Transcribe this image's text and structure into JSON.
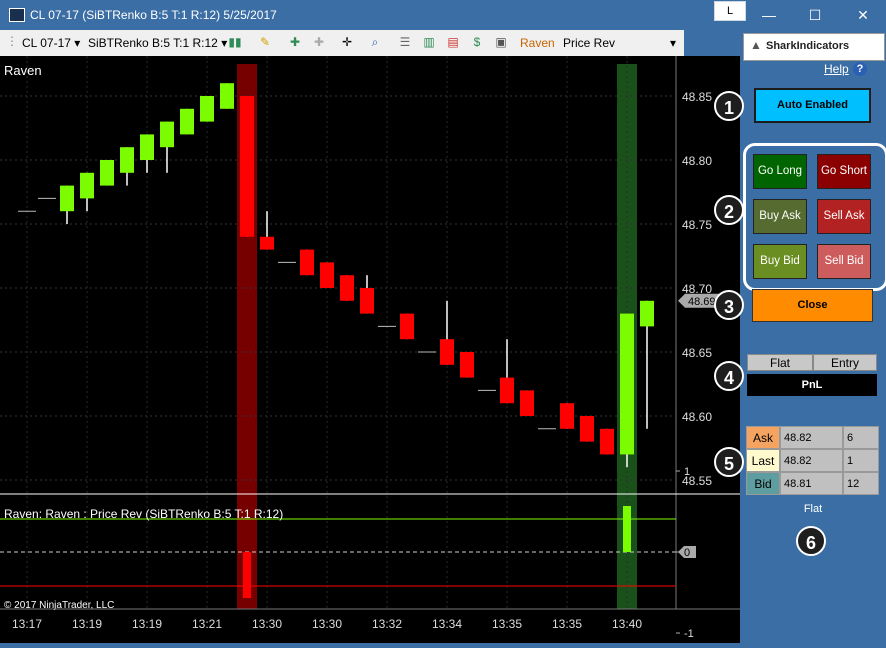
{
  "window": {
    "title": "CL 07-17 (SiBTRenko B:5 T:1 R:12)  5/25/2017",
    "mode_box": "L",
    "minimize_glyph": "—",
    "maximize_glyph": "☐",
    "close_glyph": "✕"
  },
  "toolbar": {
    "instrument": "CL 07-17",
    "bar_type": "SiBTRenko B:5 T:1 R:12",
    "indicator": "Raven",
    "strategy": "Price Rev",
    "dropdown_glyph": "▾"
  },
  "chart": {
    "panel_title": "Raven",
    "indicator_label": "Raven: Raven : Price Rev (SiBTRenko B:5 T:1 R:12)",
    "copyright": "© 2017 NinjaTrader, LLC",
    "price_ticks": [
      "48.85",
      "48.80",
      "48.75",
      "48.70",
      "48.65",
      "48.60",
      "48.55"
    ],
    "last_price_tag": "48.69",
    "indicator_ticks": [
      "1",
      "0",
      "-1"
    ],
    "time_labels": [
      "13:17",
      "13:19",
      "13:19",
      "13:21",
      "13:30",
      "13:30",
      "13:32",
      "13:34",
      "13:35",
      "13:35",
      "13:40"
    ],
    "colors": {
      "up": "#7cfc00",
      "down": "#ff0000",
      "short_signal": "#8b0000",
      "long_signal": "#1f5f1f"
    }
  },
  "chart_data": {
    "type": "candlestick",
    "price_range": [
      48.53,
      48.88
    ],
    "bars": [
      {
        "o": 48.76,
        "h": 48.76,
        "l": 48.76,
        "c": 48.76,
        "dir": "doji"
      },
      {
        "o": 48.77,
        "h": 48.77,
        "l": 48.77,
        "c": 48.77,
        "dir": "doji"
      },
      {
        "o": 48.76,
        "h": 48.78,
        "l": 48.75,
        "c": 48.78,
        "dir": "up"
      },
      {
        "o": 48.77,
        "h": 48.79,
        "l": 48.76,
        "c": 48.79,
        "dir": "up"
      },
      {
        "o": 48.78,
        "h": 48.8,
        "l": 48.78,
        "c": 48.8,
        "dir": "up"
      },
      {
        "o": 48.79,
        "h": 48.81,
        "l": 48.78,
        "c": 48.81,
        "dir": "up"
      },
      {
        "o": 48.8,
        "h": 48.82,
        "l": 48.79,
        "c": 48.82,
        "dir": "up"
      },
      {
        "o": 48.81,
        "h": 48.83,
        "l": 48.79,
        "c": 48.83,
        "dir": "up"
      },
      {
        "o": 48.82,
        "h": 48.84,
        "l": 48.82,
        "c": 48.84,
        "dir": "up"
      },
      {
        "o": 48.83,
        "h": 48.85,
        "l": 48.83,
        "c": 48.85,
        "dir": "up"
      },
      {
        "o": 48.84,
        "h": 48.86,
        "l": 48.84,
        "c": 48.86,
        "dir": "up"
      },
      {
        "o": 48.85,
        "h": 48.85,
        "l": 48.74,
        "c": 48.74,
        "dir": "down"
      },
      {
        "o": 48.74,
        "h": 48.76,
        "l": 48.73,
        "c": 48.73,
        "dir": "down"
      },
      {
        "o": 48.72,
        "h": 48.72,
        "l": 48.72,
        "c": 48.72,
        "dir": "doji"
      },
      {
        "o": 48.73,
        "h": 48.73,
        "l": 48.71,
        "c": 48.71,
        "dir": "down"
      },
      {
        "o": 48.72,
        "h": 48.72,
        "l": 48.7,
        "c": 48.7,
        "dir": "down"
      },
      {
        "o": 48.71,
        "h": 48.71,
        "l": 48.69,
        "c": 48.69,
        "dir": "down"
      },
      {
        "o": 48.7,
        "h": 48.71,
        "l": 48.68,
        "c": 48.68,
        "dir": "down"
      },
      {
        "o": 48.67,
        "h": 48.67,
        "l": 48.67,
        "c": 48.67,
        "dir": "doji"
      },
      {
        "o": 48.68,
        "h": 48.68,
        "l": 48.66,
        "c": 48.66,
        "dir": "down"
      },
      {
        "o": 48.65,
        "h": 48.65,
        "l": 48.65,
        "c": 48.65,
        "dir": "doji"
      },
      {
        "o": 48.66,
        "h": 48.69,
        "l": 48.64,
        "c": 48.64,
        "dir": "down"
      },
      {
        "o": 48.65,
        "h": 48.65,
        "l": 48.63,
        "c": 48.63,
        "dir": "down"
      },
      {
        "o": 48.62,
        "h": 48.62,
        "l": 48.62,
        "c": 48.62,
        "dir": "doji"
      },
      {
        "o": 48.63,
        "h": 48.66,
        "l": 48.61,
        "c": 48.61,
        "dir": "down"
      },
      {
        "o": 48.62,
        "h": 48.62,
        "l": 48.6,
        "c": 48.6,
        "dir": "down"
      },
      {
        "o": 48.59,
        "h": 48.59,
        "l": 48.59,
        "c": 48.59,
        "dir": "doji"
      },
      {
        "o": 48.61,
        "h": 48.61,
        "l": 48.59,
        "c": 48.59,
        "dir": "down"
      },
      {
        "o": 48.6,
        "h": 48.6,
        "l": 48.58,
        "c": 48.58,
        "dir": "down"
      },
      {
        "o": 48.59,
        "h": 48.59,
        "l": 48.57,
        "c": 48.57,
        "dir": "down"
      },
      {
        "o": 48.57,
        "h": 48.68,
        "l": 48.56,
        "c": 48.68,
        "dir": "up"
      },
      {
        "o": 48.67,
        "h": 48.69,
        "l": 48.59,
        "c": 48.69,
        "dir": "up"
      }
    ],
    "signal_bars": [
      {
        "bar_index": 11,
        "type": "short",
        "value": -1
      },
      {
        "bar_index": 30,
        "type": "long",
        "value": 1
      }
    ]
  },
  "panel": {
    "brand": "SharkIndicators",
    "help_label": "Help",
    "help_icon": "?",
    "auto_button": "Auto Enabled",
    "go_long": "Go Long",
    "go_short": "Go Short",
    "buy_ask": "Buy Ask",
    "sell_ask": "Sell Ask",
    "buy_bid": "Buy Bid",
    "sell_bid": "Sell Bid",
    "close_button": "Close",
    "flat_header": "Flat",
    "entry_header": "Entry",
    "pnl_label": "PnL",
    "quotes": [
      {
        "label": "Ask",
        "price": "48.82",
        "size": "6",
        "color": "#f4a460"
      },
      {
        "label": "Last",
        "price": "48.82",
        "size": "1",
        "color": "#fffacd"
      },
      {
        "label": "Bid",
        "price": "48.81",
        "size": "12",
        "color": "#5f9ea0"
      }
    ],
    "position": "Flat",
    "badges": [
      "1",
      "2",
      "3",
      "4",
      "5",
      "6"
    ],
    "colors": {
      "auto": "#00bfff",
      "go_long": "#006400",
      "go_short": "#8b0000",
      "buy_ask": "#556b2f",
      "sell_ask": "#b22222",
      "buy_bid": "#6b8e23",
      "sell_bid": "#cd5c5c",
      "close": "#ff8c00"
    }
  }
}
